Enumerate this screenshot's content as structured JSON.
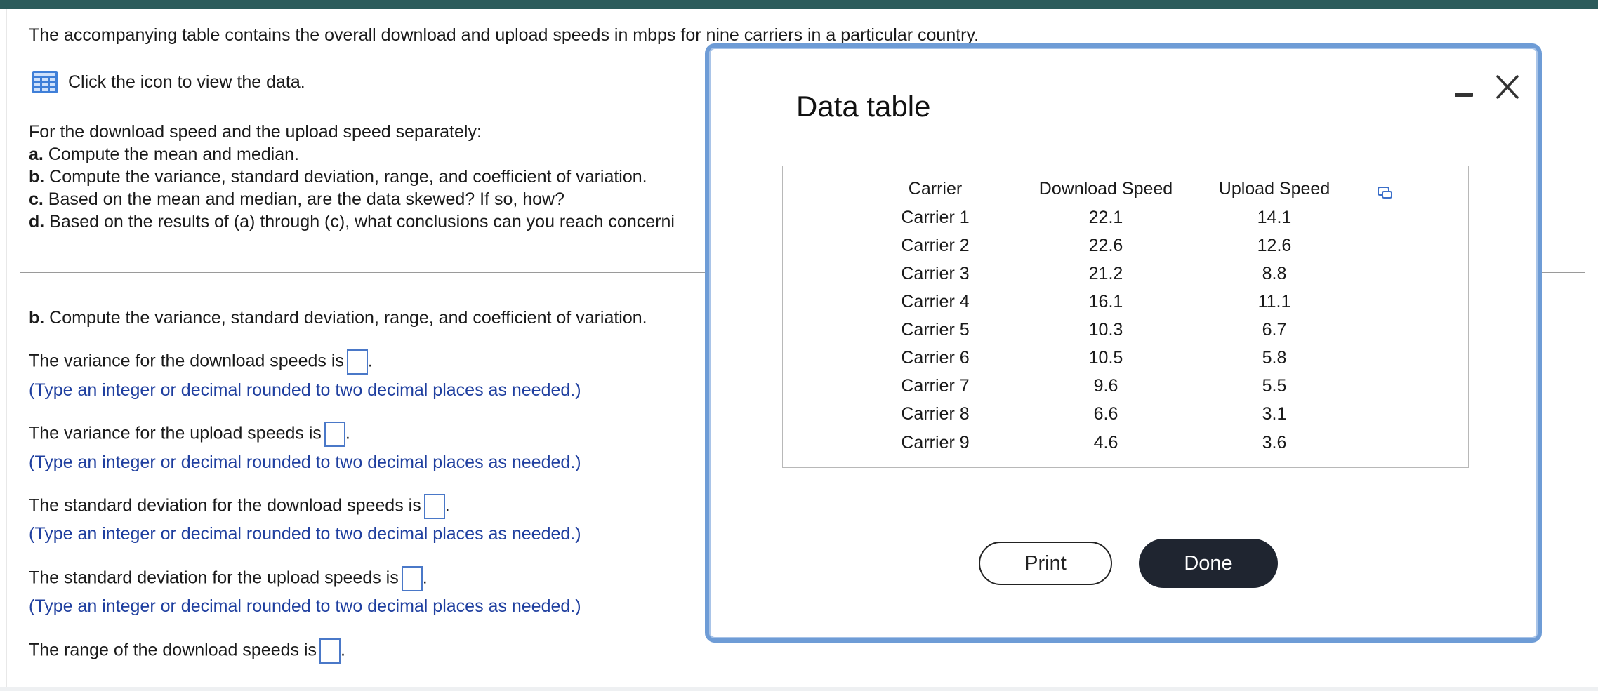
{
  "intro": "The accompanying table contains the overall download and upload speeds in mbps for nine carriers in a particular country.",
  "data_link_label": "Click the icon to view the data.",
  "instructions": {
    "lead": "For the download speed and the upload speed separately:",
    "a_label": "a.",
    "a_text": " Compute the mean and median.",
    "b_label": "b.",
    "b_text": " Compute the variance, standard deviation, range, and coefficient of variation.",
    "c_label": "c.",
    "c_text": " Based on the mean and median, are the data skewed? If so, how?",
    "d_label": "d.",
    "d_text": " Based on the results of (a) through (c), what conclusions can you reach concerni"
  },
  "part_b": {
    "label": "b.",
    "text": " Compute the variance, standard deviation, range, and coefficient of variation."
  },
  "questions": [
    {
      "prompt": "The variance for the download speeds is",
      "hint": "(Type an integer or decimal rounded to two decimal places as needed.)"
    },
    {
      "prompt": "The variance for the upload speeds is",
      "hint": "(Type an integer or decimal rounded to two decimal places as needed.)"
    },
    {
      "prompt": "The standard deviation for the download speeds is",
      "hint": "(Type an integer or decimal rounded to two decimal places as needed.)"
    },
    {
      "prompt": "The standard deviation for the upload speeds is",
      "hint": "(Type an integer or decimal rounded to two decimal places as needed.)"
    },
    {
      "prompt": "The range of the download speeds is",
      "hint": ""
    }
  ],
  "modal": {
    "title": "Data table",
    "columns": [
      "Carrier",
      "Download Speed",
      "Upload Speed"
    ],
    "rows": [
      [
        "Carrier 1",
        "22.1",
        "14.1"
      ],
      [
        "Carrier 2",
        "22.6",
        "12.6"
      ],
      [
        "Carrier 3",
        "21.2",
        "8.8"
      ],
      [
        "Carrier 4",
        "16.1",
        "11.1"
      ],
      [
        "Carrier 5",
        "10.3",
        "6.7"
      ],
      [
        "Carrier 6",
        "10.5",
        "5.8"
      ],
      [
        "Carrier 7",
        "9.6",
        "5.5"
      ],
      [
        "Carrier 8",
        "6.6",
        "3.1"
      ],
      [
        "Carrier 9",
        "4.6",
        "3.6"
      ]
    ],
    "print_label": "Print",
    "done_label": "Done"
  },
  "icons": {
    "data": "grid-table-icon",
    "minimize": "minimize-icon",
    "close": "close-icon",
    "copy": "copy-icon"
  },
  "colors": {
    "topbar": "#2c5b5b",
    "hint_text": "#1f3f9f",
    "modal_border": "#6e9cd6",
    "done_button": "#1f2530"
  }
}
